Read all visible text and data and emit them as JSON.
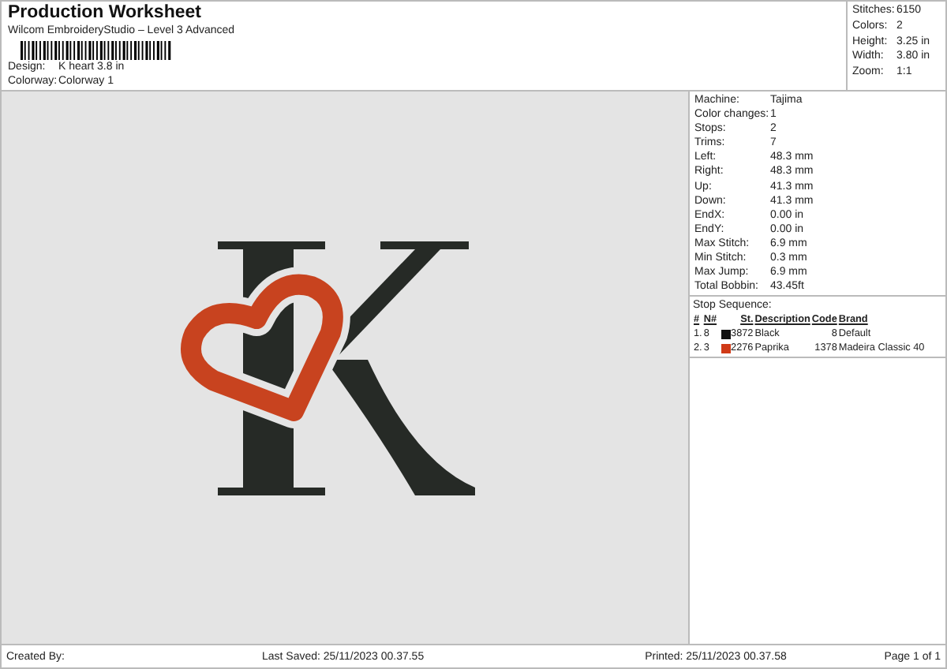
{
  "header": {
    "title": "Production Worksheet",
    "subtitle": "Wilcom EmbroideryStudio – Level 3 Advanced",
    "fields": [
      {
        "label": "Design:",
        "value": "K heart 3.8 in"
      },
      {
        "label": "Colorway:",
        "value": "Colorway 1"
      }
    ]
  },
  "summary": [
    {
      "label": "Stitches:",
      "value": "6150"
    },
    {
      "label": "Colors:",
      "value": "2"
    },
    {
      "label": "Height:",
      "value": "3.25 in"
    },
    {
      "label": "Width:",
      "value": "3.80 in"
    },
    {
      "label": "Zoom:",
      "value": "1:1"
    }
  ],
  "details": [
    {
      "label": "Machine:",
      "value": "Tajima"
    },
    {
      "label": "Color changes:",
      "value": "1"
    },
    {
      "label": "Stops:",
      "value": "2"
    },
    {
      "label": "Trims:",
      "value": "7"
    },
    {
      "label": "Left:",
      "value": "48.3 mm"
    },
    {
      "label": "Right:",
      "value": "48.3 mm"
    },
    {
      "label": "Up:",
      "value": "41.3 mm"
    },
    {
      "label": "Down:",
      "value": "41.3 mm"
    },
    {
      "label": "EndX:",
      "value": "0.00 in"
    },
    {
      "label": "EndY:",
      "value": "0.00 in"
    },
    {
      "label": "Max Stitch:",
      "value": "6.9 mm"
    },
    {
      "label": "Min Stitch:",
      "value": "0.3 mm"
    },
    {
      "label": "Max Jump:",
      "value": "6.9 mm"
    },
    {
      "label": "Total Bobbin:",
      "value": "43.45ft"
    }
  ],
  "stop_sequence": {
    "title": "Stop Sequence:",
    "columns": [
      "#",
      "N#",
      "St.",
      "Description",
      "Code",
      "Brand"
    ],
    "rows": [
      {
        "index": "1.",
        "needle": "8",
        "color": "#111111",
        "stitches": "3872",
        "description": "Black",
        "code": "8",
        "brand": "Default"
      },
      {
        "index": "2.",
        "needle": "3",
        "color": "#d03a17",
        "stitches": "2276",
        "description": "Paprika",
        "code": "1378",
        "brand": "Madeira Classic 40"
      }
    ]
  },
  "footer": {
    "created": "Created By:",
    "saved": "Last Saved: 25/11/2023 00.37.55",
    "printed": "Printed: 25/11/2023 00.37.58",
    "page": "Page 1 of 1"
  }
}
